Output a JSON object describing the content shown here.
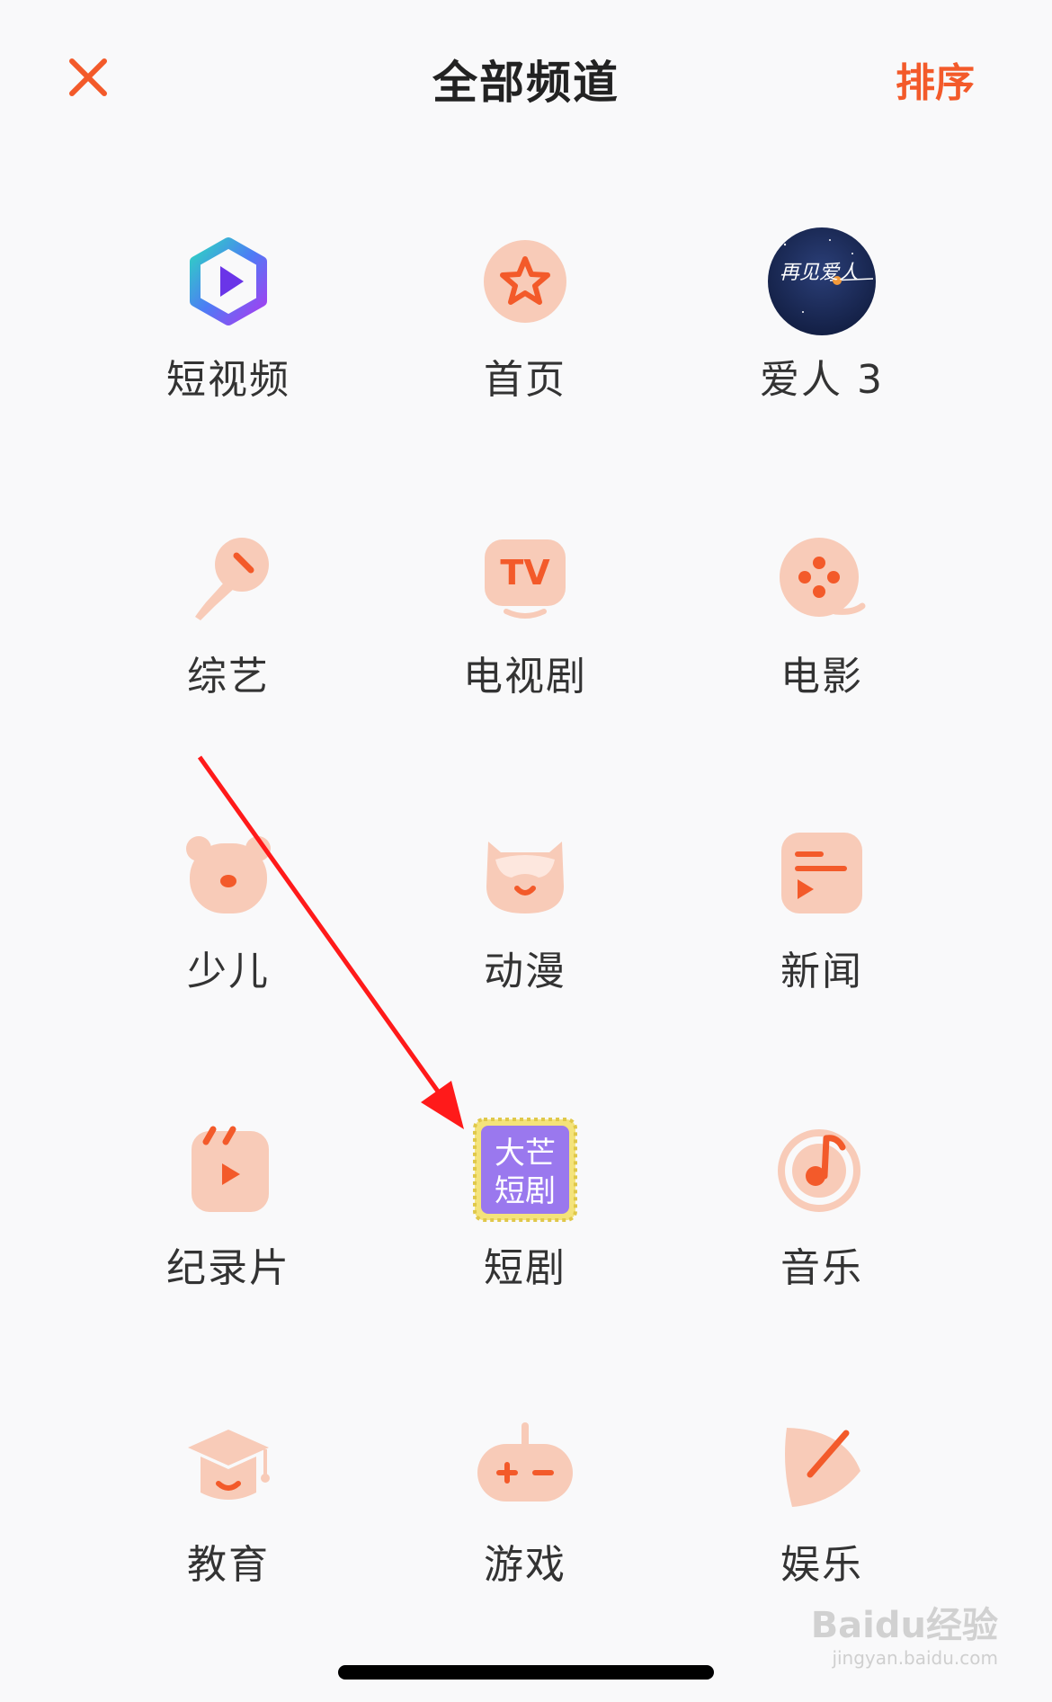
{
  "header": {
    "title": "全部频道",
    "sort_label": "排序",
    "close_icon": "close-icon"
  },
  "colors": {
    "accent": "#f35a2a",
    "icon_bg": "#f8cbb8",
    "icon_fg": "#f35a2a",
    "purple": "#8a6cf0"
  },
  "channels": [
    {
      "label": "短视频",
      "icon": "short-video-icon"
    },
    {
      "label": "首页",
      "icon": "star-icon"
    },
    {
      "label": "爱人 3",
      "icon": "poster-thumbnail"
    },
    {
      "label": "综艺",
      "icon": "microphone-icon"
    },
    {
      "label": "电视剧",
      "icon": "tv-icon"
    },
    {
      "label": "电影",
      "icon": "film-reel-icon"
    },
    {
      "label": "少儿",
      "icon": "bear-icon"
    },
    {
      "label": "动漫",
      "icon": "anime-face-icon"
    },
    {
      "label": "新闻",
      "icon": "news-icon"
    },
    {
      "label": "纪录片",
      "icon": "documentary-icon"
    },
    {
      "label": "短剧",
      "icon": "short-drama-badge"
    },
    {
      "label": "音乐",
      "icon": "music-note-icon"
    },
    {
      "label": "教育",
      "icon": "graduation-cap-icon"
    },
    {
      "label": "游戏",
      "icon": "gamepad-icon"
    },
    {
      "label": "娱乐",
      "icon": "leaf-pen-icon"
    }
  ],
  "badge": {
    "short_drama_text_1": "大芒",
    "short_drama_text_2": "短剧"
  },
  "poster": {
    "caption": "再见爱人"
  },
  "watermark": {
    "logo_text": "Baidu经验",
    "sub_text": "jingyan.baidu.com"
  }
}
